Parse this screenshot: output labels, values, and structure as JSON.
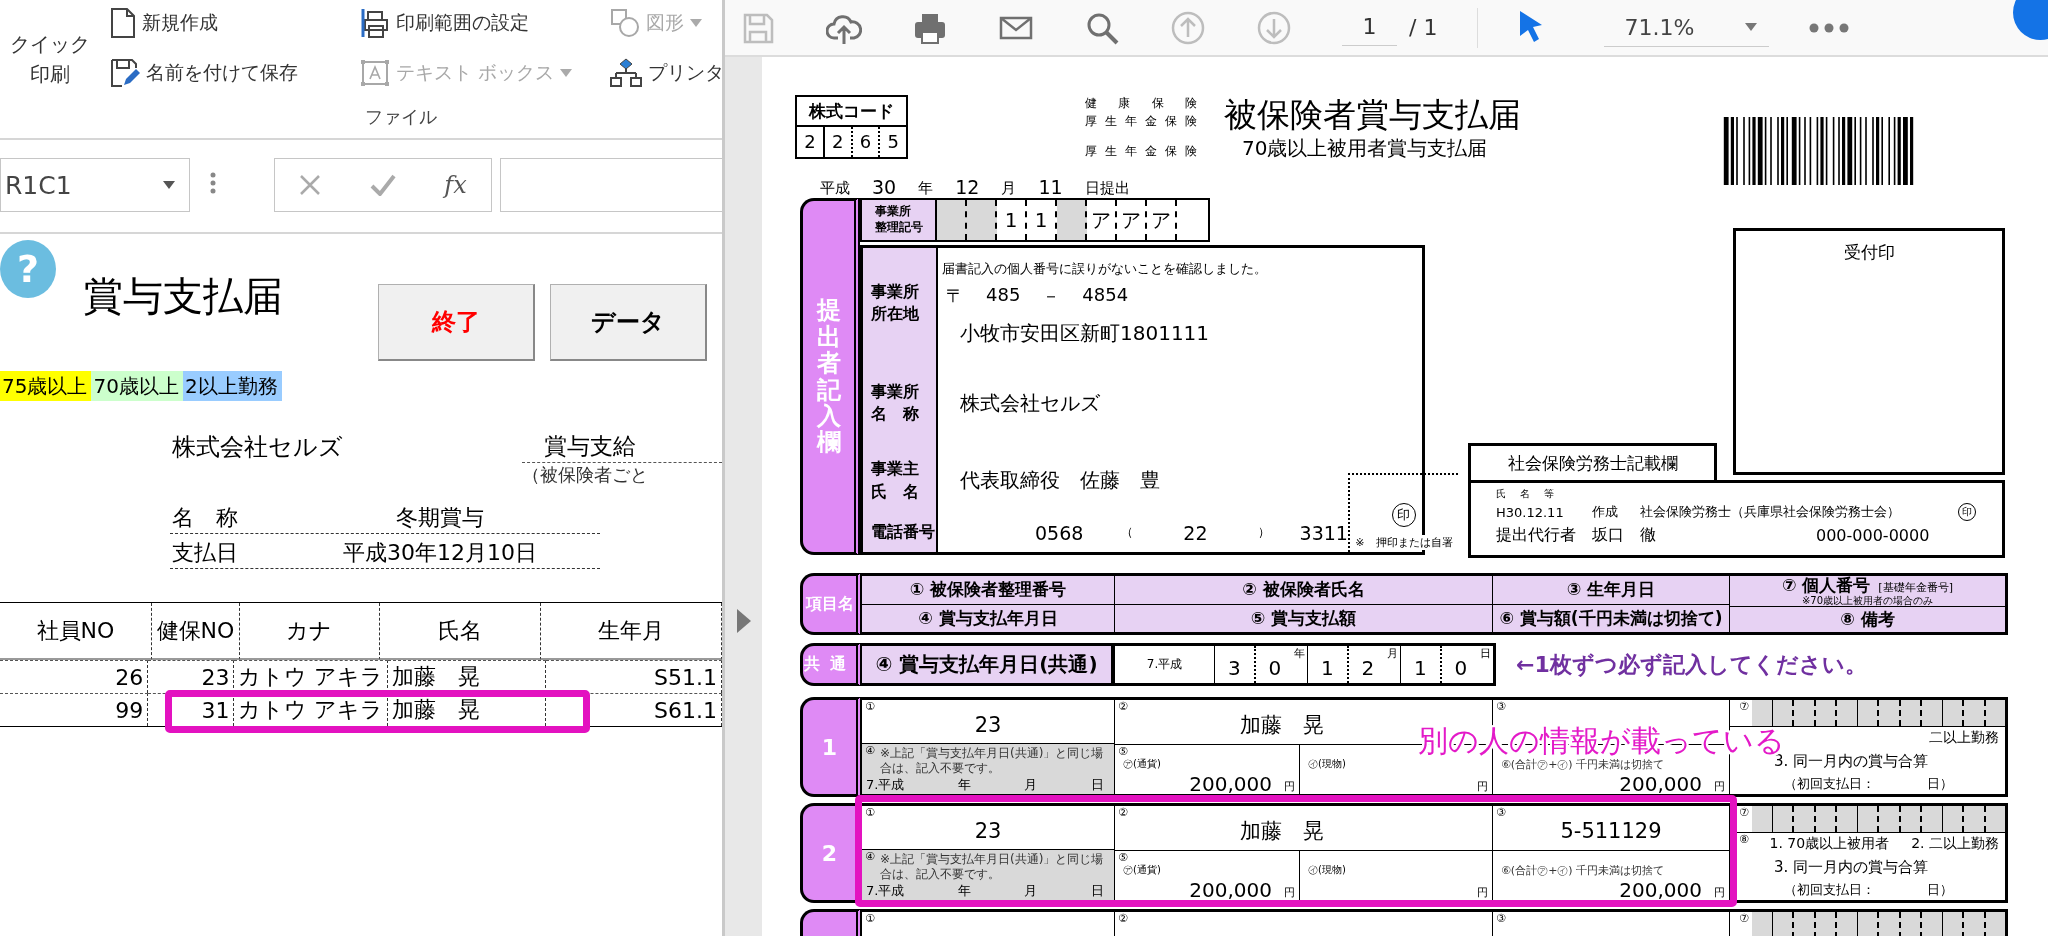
{
  "excel": {
    "ribbon": {
      "quick_print": [
        "クイック",
        "印刷"
      ],
      "commands": [
        {
          "kind": "new",
          "label": "新規作成",
          "disabled": false,
          "dropdown": false
        },
        {
          "kind": "save-as",
          "label": "名前を付けて保存",
          "disabled": false,
          "dropdown": false
        },
        {
          "kind": "print-area",
          "label": "印刷範囲の設定",
          "disabled": false,
          "dropdown": false
        },
        {
          "kind": "text-box",
          "label": "テキスト ボックス",
          "disabled": true,
          "dropdown": true
        },
        {
          "kind": "shape",
          "label": "図形",
          "disabled": true,
          "dropdown": true
        },
        {
          "kind": "printer",
          "label": "プリンタ",
          "disabled": false,
          "dropdown": false
        }
      ],
      "group_label": "ファイル"
    },
    "formula_bar": {
      "name_box": "R1C1",
      "fx": "fx"
    },
    "sheet": {
      "help": "?",
      "title": "賞与支払届",
      "buttons": [
        {
          "kind": "exit",
          "label": "終了"
        },
        {
          "kind": "data",
          "label": "データ"
        }
      ],
      "legend": [
        {
          "label": "75歳以上",
          "color": "#ffff00"
        },
        {
          "label": "70歳以上",
          "color": "#ccffcc"
        },
        {
          "label": "2以上勤務",
          "color": "#99ccff"
        }
      ],
      "company": "株式会社セルズ",
      "side_title": "賞与支給",
      "side_note": "（被保険者ごと",
      "fields": [
        {
          "label": "名　称",
          "value": "冬期賞与"
        },
        {
          "label": "支払日",
          "value": "平成30年12月10日"
        }
      ],
      "table": {
        "columns": [
          "社員NO",
          "健保NO",
          "カナ",
          "氏名",
          "生年月"
        ],
        "rows": [
          {
            "cells": [
              "26",
              "23",
              "カトウ アキラ",
              "加藤　晃",
              "S51.1"
            ],
            "highlighted": false
          },
          {
            "cells": [
              "99",
              "31",
              "カトウ アキラ",
              "加藤　晃",
              "S61.1"
            ],
            "highlighted": true
          }
        ]
      }
    }
  },
  "pdf": {
    "toolbar": {
      "tools": [
        {
          "kind": "save",
          "disabled": true
        },
        {
          "kind": "upload",
          "disabled": false
        },
        {
          "kind": "print",
          "disabled": false
        },
        {
          "kind": "mail",
          "disabled": false
        },
        {
          "kind": "search",
          "disabled": false
        },
        {
          "kind": "up",
          "disabled": true
        },
        {
          "kind": "down",
          "disabled": true
        }
      ],
      "page": "1",
      "page_total": "/ 1",
      "zoom": "71.1%"
    },
    "form": {
      "code": {
        "label": "株式コード",
        "digits": [
          "2",
          "2",
          "6",
          "5"
        ]
      },
      "insurance": [
        "健康保険",
        "厚生年金保険",
        "厚生年金保険"
      ],
      "title": "被保険者賞与支払届",
      "subtitle": "70歳以上被用者賞与支払届",
      "submit_date": [
        {
          "kind": "label",
          "text": "平成"
        },
        {
          "kind": "value",
          "text": "30"
        },
        {
          "kind": "label",
          "text": "年"
        },
        {
          "kind": "value",
          "text": "12"
        },
        {
          "kind": "label",
          "text": "月"
        },
        {
          "kind": "value",
          "text": "11"
        },
        {
          "kind": "label",
          "text": "日提出"
        }
      ],
      "submitter": {
        "tab": "提出者記入欄",
        "office_code": {
          "label": [
            "事業所",
            "整理記号"
          ],
          "cells": [
            {
              "kind": "shaded"
            },
            {
              "kind": "shaded"
            },
            {
              "kind": "char",
              "text": "1"
            },
            {
              "kind": "char",
              "text": "1"
            },
            {
              "kind": "shaded"
            },
            {
              "kind": "char",
              "text": "ア"
            },
            {
              "kind": "char",
              "text": "ア"
            },
            {
              "kind": "char",
              "text": "ア"
            },
            {
              "kind": "empty"
            }
          ]
        },
        "labels": [
          [
            "事業所",
            "所在地"
          ],
          [
            "事業所",
            "名　称"
          ],
          [
            "事業主",
            "氏　名"
          ],
          [
            "電話番号"
          ]
        ],
        "note": "届書記入の個人番号に誤りがないことを確認しました。",
        "postal": {
          "mark": "〒",
          "first": "485",
          "dash": "－",
          "second": "4854"
        },
        "address": "小牧市安田区新町1801111",
        "company": "株式会社セルズ",
        "owner": "代表取締役　佐藤　豊",
        "phone": {
          "area": "0568",
          "open": "（",
          "local": "22",
          "close": "）",
          "number": "3311"
        },
        "seal": {
          "mark": "印",
          "note": "※　押印または自署"
        }
      },
      "receipt_stamp": "受付印",
      "agent": {
        "title": "社会保険労務士記載欄",
        "name_label": "氏　名　等",
        "date": "H30.12.11",
        "made": "作成",
        "org": "社会保険労務士（兵庫県社会保険労務士会）",
        "seal": "印",
        "role": "提出代行者",
        "person": "坂口　徹",
        "phone": "000-000-0000"
      },
      "table": {
        "tab": "項目名",
        "headers": [
          [
            "① 被保険者整理番号",
            "④ 賞与支払年月日"
          ],
          [
            "② 被保険者氏名",
            "⑤ 賞与支払額"
          ],
          [
            "③ 生年月日",
            "⑥ 賞与額(千円未満は切捨て)"
          ]
        ],
        "personal": {
          "title": "⑦ 個人番号",
          "sub": "[基礎年金番号]",
          "note": "※70歳以上被用者の場合のみ"
        },
        "remarks_header": "⑧ 備考",
        "common": {
          "tab": "共通",
          "label": "④ 賞与支払年月日(共通)",
          "era": "7.平成",
          "year": [
            "3",
            "0"
          ],
          "year_unit": "年",
          "month": [
            "1",
            "2"
          ],
          "month_unit": "月",
          "day": [
            "1",
            "0"
          ],
          "day_unit": "日",
          "message": "←1枚ずつ必ず記入してください。"
        },
        "rows": [
          {
            "number": "1",
            "marks": [
              "①",
              "②",
              "③",
              "⑦"
            ],
            "insured_no": "23",
            "name": "加藤　晃",
            "pay_date": {
              "mark": "④",
              "note": "※上記「賞与支払年月日(共通)」と同じ場合は、記入不要です。",
              "era": "7.平成",
              "units": [
                "年",
                "月",
                "日"
              ]
            },
            "amount": {
              "mark": "⑤",
              "cash_label": "㋐(通貨)",
              "cash": "200,000",
              "cash_unit": "円",
              "goods_label": "㋑(現物)",
              "goods_unit": "円"
            },
            "total": {
              "label": "⑥(合計㋐+㋑) 千円未満は切捨て",
              "value": "200,000",
              "unit": "円"
            },
            "remarks": {
              "options": [
                "二以上勤務"
              ],
              "combined": "3. 同一月内の賞与合算",
              "first_pay": "（初回支払日：　　　　日）"
            },
            "highlighted": false
          },
          {
            "number": "2",
            "marks": [
              "①",
              "②",
              "③",
              "⑦"
            ],
            "insured_no": "23",
            "name": "加藤　晃",
            "birth": "5-511129",
            "pay_date": {
              "mark": "④",
              "note": "※上記「賞与支払年月日(共通)」と同じ場合は、記入不要です。",
              "era": "7.平成",
              "units": [
                "年",
                "月",
                "日"
              ]
            },
            "amount": {
              "mark": "⑤",
              "cash_label": "㋐(通貨)",
              "cash": "200,000",
              "cash_unit": "円",
              "goods_label": "㋑(現物)",
              "goods_unit": "円"
            },
            "total": {
              "label": "⑥(合計㋐+㋑) 千円未満は切捨て",
              "value": "200,000",
              "unit": "円"
            },
            "remarks": {
              "mark": "⑧",
              "options": [
                "1. 70歳以上被用者",
                "2. 二以上勤務"
              ],
              "combined": "3. 同一月内の賞与合算",
              "first_pay": "（初回支払日：　　　　日）"
            },
            "highlighted": true
          },
          {
            "marks": [
              "①",
              "②",
              "③",
              "⑦"
            ],
            "highlighted": false
          }
        ],
        "annotation": "別の人の情報が載っている"
      }
    }
  }
}
